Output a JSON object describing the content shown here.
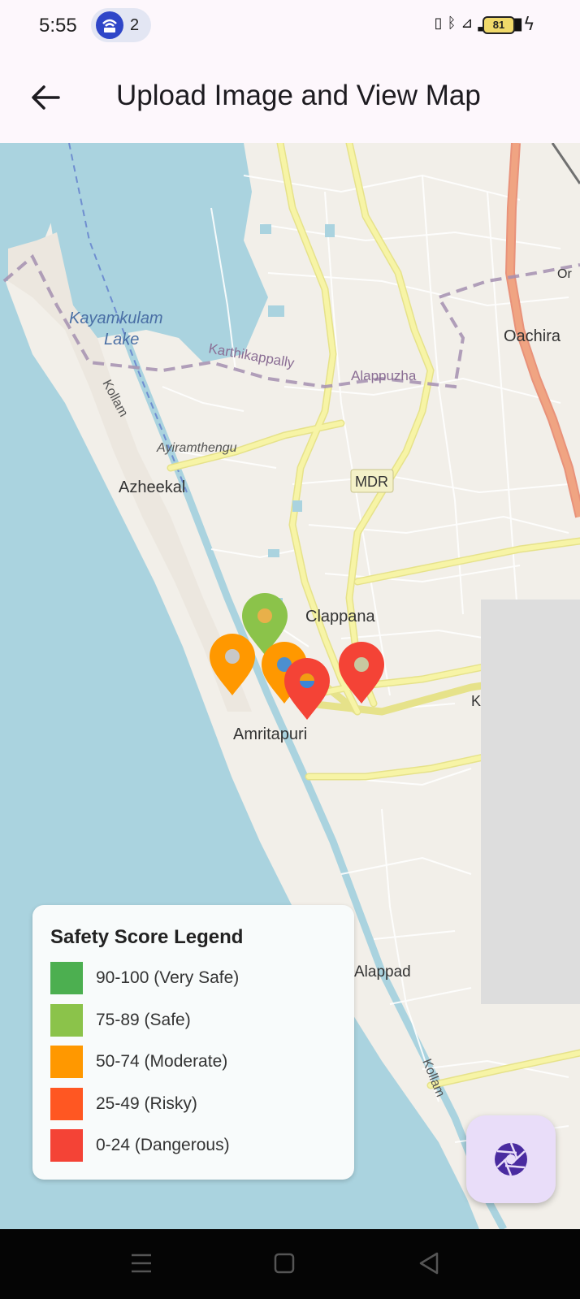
{
  "status_bar": {
    "time": "5:55",
    "notification_count": "2",
    "battery": "81",
    "icons": [
      "vibrate-icon",
      "bluetooth-icon",
      "volte-icon",
      "5g-signal-icon",
      "battery-icon",
      "charging-icon"
    ]
  },
  "app_bar": {
    "title": "Upload Image and View Map",
    "back_icon": "arrow-left-icon"
  },
  "map": {
    "place_labels": {
      "kayamkulam_1": "Kayamkulam",
      "kayamkulam_2": "Lake",
      "oachira": "Oachira",
      "karthikappally": "Karthikappally",
      "alappuzha": "Alappuzha",
      "kollam_1": "Kollam",
      "ayiramthengu": "Ayiramthengu",
      "azheekal": "Azheekal",
      "mdr": "MDR",
      "clappana": "Clappana",
      "amritapuri": "Amritapuri",
      "alappad": "Alappad",
      "kollam_2": "Kollam",
      "or_partial": "Or",
      "k_partial": "K"
    },
    "markers": [
      {
        "category": "75-89 (Safe)",
        "color": "#8bc34a"
      },
      {
        "category": "50-74 (Moderate)",
        "color": "#ff9800"
      },
      {
        "category": "50-74 (Moderate)",
        "color": "#ff9800"
      },
      {
        "category": "0-24 (Dangerous)",
        "color": "#f44336"
      },
      {
        "category": "0-24 (Dangerous)",
        "color": "#f44336"
      }
    ],
    "colors": {
      "water": "#aad3df",
      "land": "#f2efe9",
      "road_major": "#f7f4a6",
      "road_primary": "#f0a482",
      "boundary": "#a48fb0",
      "tile_missing": "#dddddd"
    }
  },
  "legend": {
    "title": "Safety Score Legend",
    "items": [
      {
        "label": "90-100 (Very Safe)",
        "color": "#4caf50"
      },
      {
        "label": "75-89 (Safe)",
        "color": "#8bc34a"
      },
      {
        "label": "50-74 (Moderate)",
        "color": "#ff9800"
      },
      {
        "label": "25-49 (Risky)",
        "color": "#ff5722"
      },
      {
        "label": "0-24 (Dangerous)",
        "color": "#f44336"
      }
    ]
  },
  "fab": {
    "icon": "camera-shutter-icon",
    "color": "#e9ddf9",
    "icon_color": "#4a2ba0"
  },
  "nav_bar": {
    "icons": [
      "menu-icon",
      "home-square-icon",
      "back-triangle-icon"
    ]
  }
}
